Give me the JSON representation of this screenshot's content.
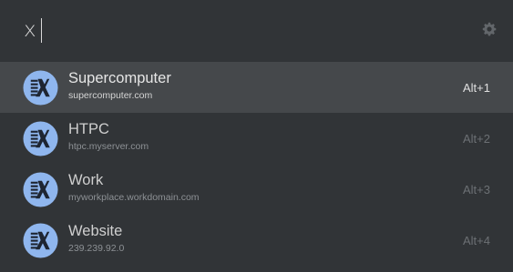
{
  "search": {
    "query": "x"
  },
  "colors": {
    "background": "#313437",
    "selected_row": "#45484b",
    "icon_circle": "#8fb6ee",
    "icon_glyph": "#1e2532"
  },
  "icons": {
    "settings": "gear-icon",
    "result": "x-app-icon"
  },
  "results": [
    {
      "title": "Supercomputer",
      "subtitle": "supercomputer.com",
      "shortcut": "Alt+1",
      "selected": true
    },
    {
      "title": "HTPC",
      "subtitle": "htpc.myserver.com",
      "shortcut": "Alt+2",
      "selected": false
    },
    {
      "title": "Work",
      "subtitle": "myworkplace.workdomain.com",
      "shortcut": "Alt+3",
      "selected": false
    },
    {
      "title": "Website",
      "subtitle": "239.239.92.0",
      "shortcut": "Alt+4",
      "selected": false
    }
  ]
}
